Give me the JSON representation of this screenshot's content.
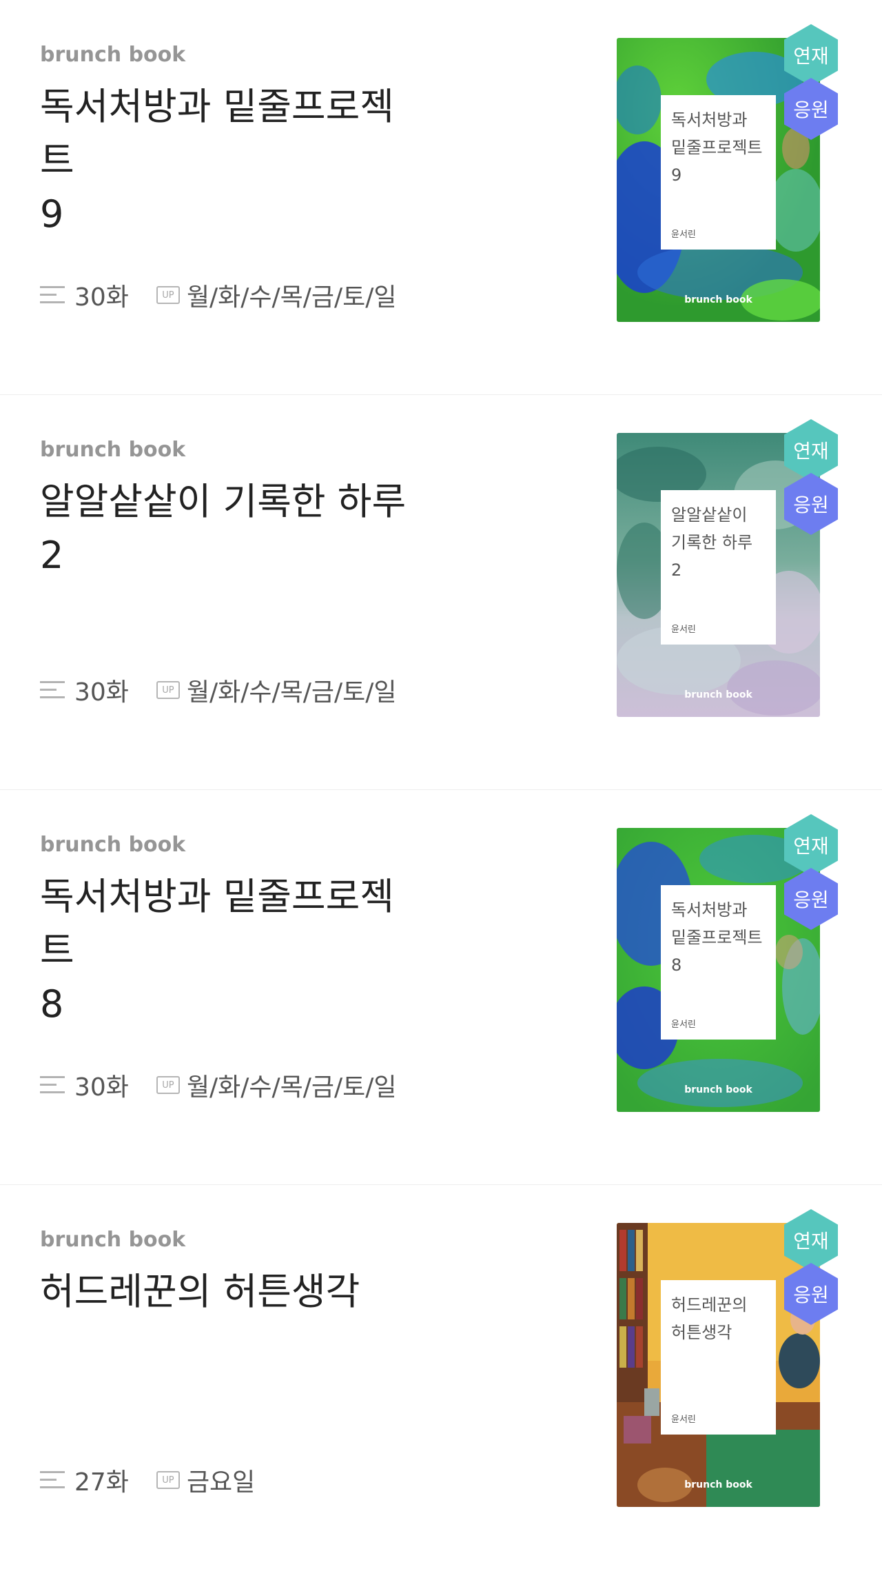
{
  "colors": {
    "serial_badge": "#56c6bd",
    "support_badge": "#6d7df0",
    "label_gray": "#959595"
  },
  "books": [
    {
      "label": "brunch book",
      "title_lines": [
        "독서처방과 밑줄프로젝트",
        "9"
      ],
      "episodes": "30화",
      "schedule": "월/화/수/목/금/토/일",
      "badge_serial": "연재",
      "badge_support": "응원",
      "cover": {
        "title_lines": [
          "독서처방과",
          "밑줄프로젝트",
          "9"
        ],
        "author": "윤서린",
        "brand": "brunch book",
        "theme": "green-blue-painting"
      }
    },
    {
      "label": "brunch book",
      "title_lines": [
        "알알샅샅이 기록한 하루",
        "2"
      ],
      "episodes": "30화",
      "schedule": "월/화/수/목/금/토/일",
      "badge_serial": "연재",
      "badge_support": "응원",
      "cover": {
        "title_lines": [
          "알알샅샅이",
          "기록한 하루",
          "2"
        ],
        "author": "윤서린",
        "brand": "brunch book",
        "theme": "teal-lavender-texture"
      }
    },
    {
      "label": "brunch book",
      "title_lines": [
        "독서처방과 밑줄프로젝트",
        "8"
      ],
      "episodes": "30화",
      "schedule": "월/화/수/목/금/토/일",
      "badge_serial": "연재",
      "badge_support": "응원",
      "cover": {
        "title_lines": [
          "독서처방과",
          "밑줄프로젝트",
          "8"
        ],
        "author": "윤서린",
        "brand": "brunch book",
        "theme": "green-blue-painting"
      }
    },
    {
      "label": "brunch book",
      "title_lines": [
        "허드레꾼의 허튼생각"
      ],
      "episodes": "27화",
      "schedule": "금요일",
      "badge_serial": "연재",
      "badge_support": "응원",
      "cover": {
        "title_lines": [
          "허드레꾼의",
          "허튼생각"
        ],
        "author": "윤서린",
        "brand": "brunch book",
        "theme": "warm-interior-painting"
      }
    }
  ]
}
